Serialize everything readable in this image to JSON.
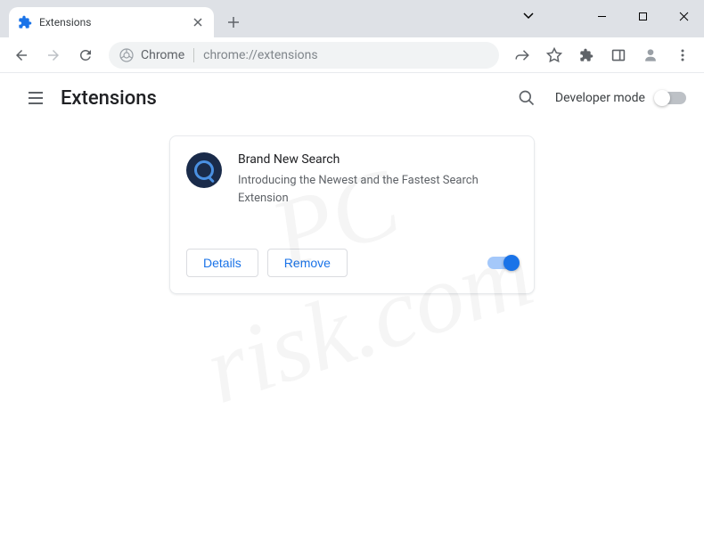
{
  "tab": {
    "title": "Extensions"
  },
  "address": {
    "label": "Chrome",
    "url": "chrome://extensions"
  },
  "page": {
    "title": "Extensions",
    "dev_mode_label": "Developer mode"
  },
  "extension": {
    "name": "Brand New Search",
    "description": "Introducing the Newest and the Fastest Search Extension",
    "details_label": "Details",
    "remove_label": "Remove",
    "enabled": true
  },
  "watermark": {
    "line1": "PC",
    "line2": "risk.com"
  }
}
